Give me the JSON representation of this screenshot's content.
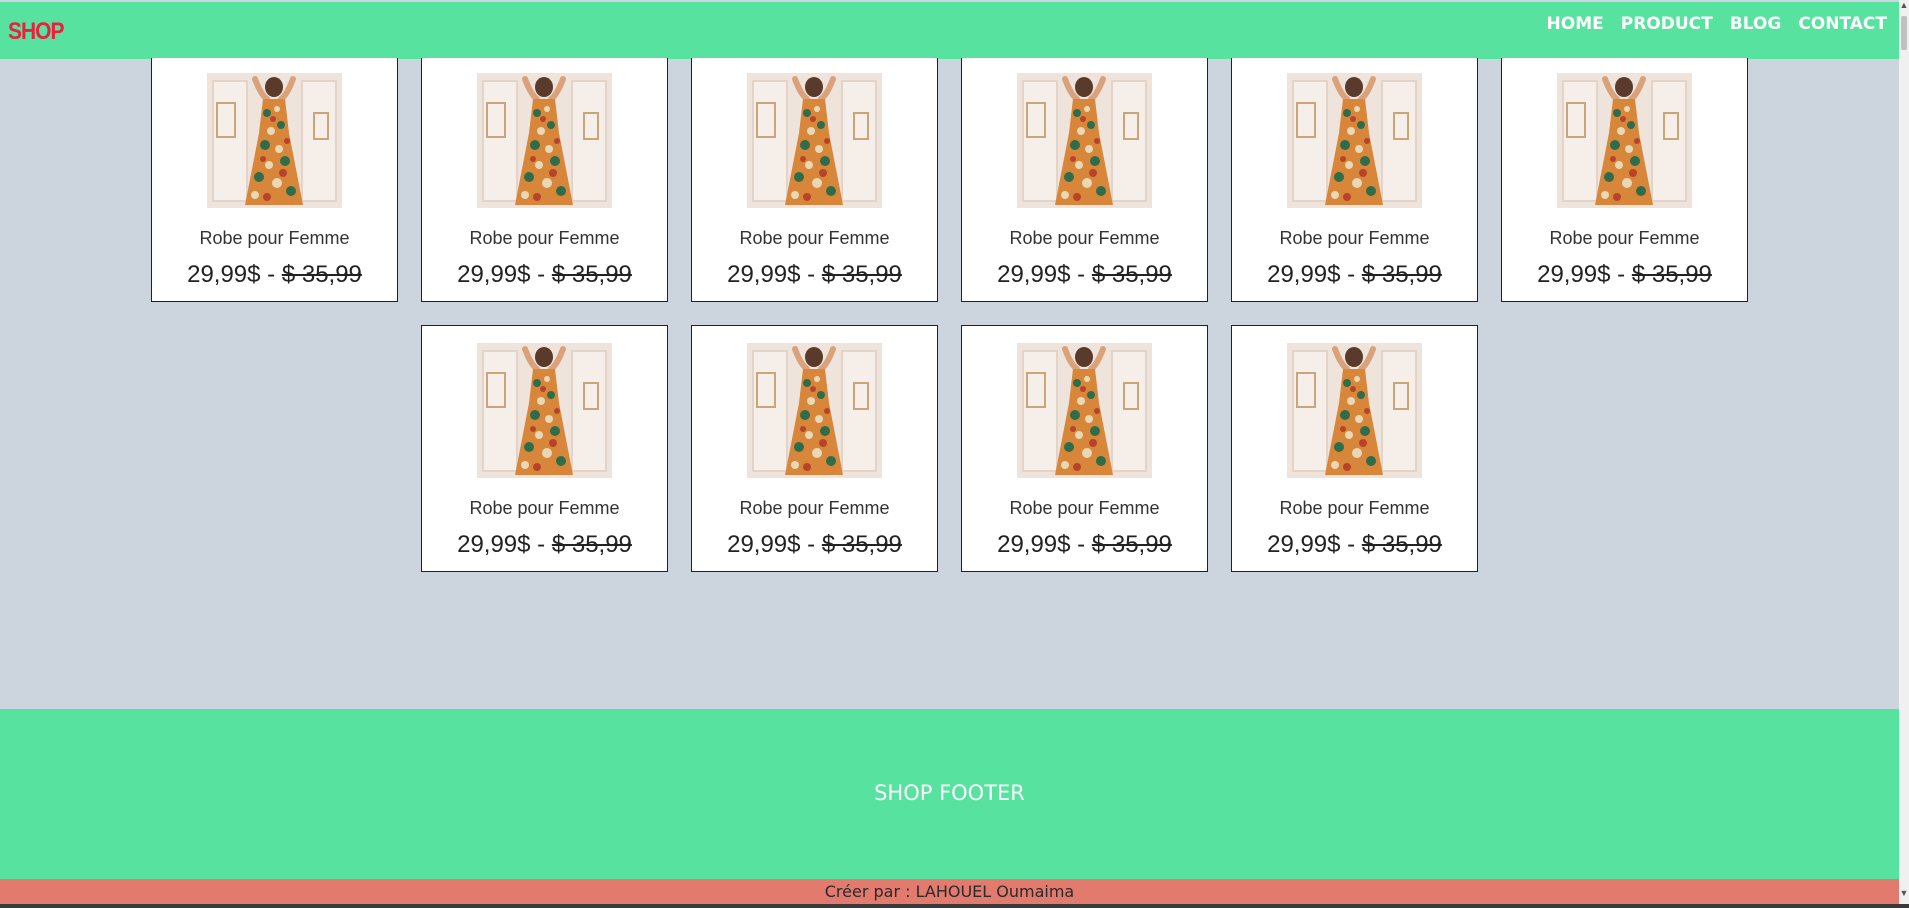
{
  "header": {
    "logo": "SHOP",
    "nav": [
      "HOME",
      "PRODUCT",
      "BLOG",
      "CONTACT"
    ]
  },
  "products": [
    {
      "name": "Robe pour Femme",
      "price": "29,99$",
      "separator": " - ",
      "old_price": "$ 35,99"
    },
    {
      "name": "Robe pour Femme",
      "price": "29,99$",
      "separator": " - ",
      "old_price": "$ 35,99"
    },
    {
      "name": "Robe pour Femme",
      "price": "29,99$",
      "separator": " - ",
      "old_price": "$ 35,99"
    },
    {
      "name": "Robe pour Femme",
      "price": "29,99$",
      "separator": " - ",
      "old_price": "$ 35,99"
    },
    {
      "name": "Robe pour Femme",
      "price": "29,99$",
      "separator": " - ",
      "old_price": "$ 35,99"
    },
    {
      "name": "Robe pour Femme",
      "price": "29,99$",
      "separator": " - ",
      "old_price": "$ 35,99"
    },
    {
      "name": "Robe pour Femme",
      "price": "29,99$",
      "separator": " - ",
      "old_price": "$ 35,99"
    },
    {
      "name": "Robe pour Femme",
      "price": "29,99$",
      "separator": " - ",
      "old_price": "$ 35,99"
    },
    {
      "name": "Robe pour Femme",
      "price": "29,99$",
      "separator": " - ",
      "old_price": "$ 35,99"
    },
    {
      "name": "Robe pour Femme",
      "price": "29,99$",
      "separator": " - ",
      "old_price": "$ 35,99"
    }
  ],
  "footer": {
    "text": "SHOP FOOTER",
    "credit": "Créer par : LAHOUEL Oumaima"
  },
  "colors": {
    "header_bg": "#57e29f",
    "logo": "#e8213f",
    "page_bg": "#ccd5de",
    "credit_bg": "#e37a6e"
  }
}
